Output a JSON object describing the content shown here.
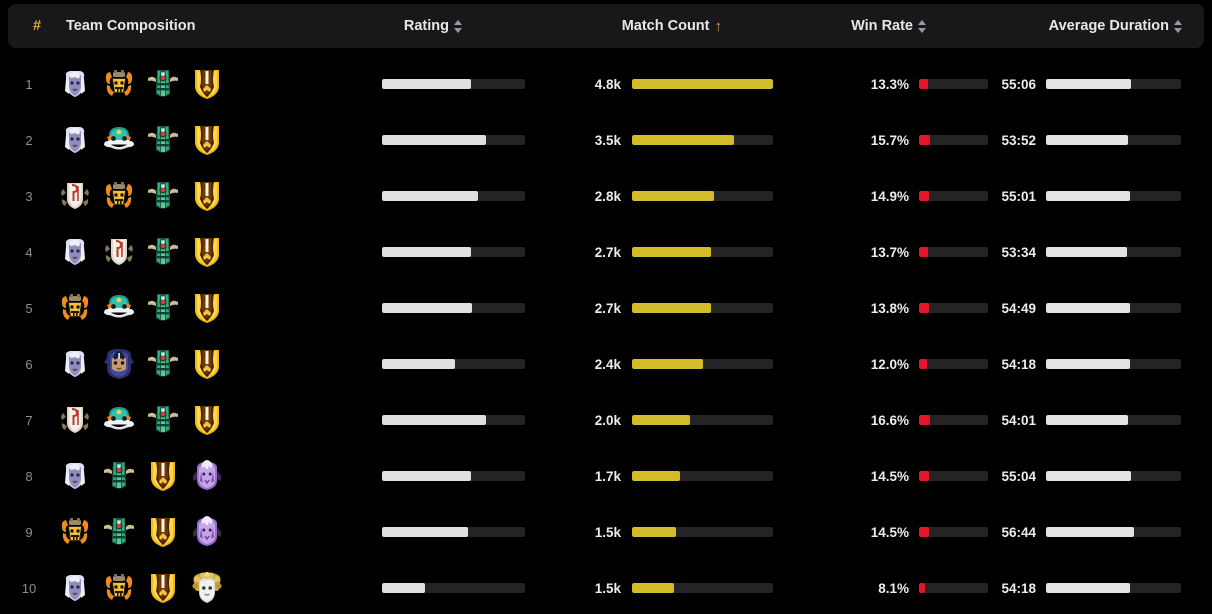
{
  "table": {
    "columns": [
      {
        "key": "rank",
        "label": "#",
        "sort": "none"
      },
      {
        "key": "comp",
        "label": "Team Composition",
        "sort": "none"
      },
      {
        "key": "rating",
        "label": "Rating",
        "sort": "sortable"
      },
      {
        "key": "match",
        "label": "Match Count",
        "sort": "asc"
      },
      {
        "key": "winrate",
        "label": "Win Rate",
        "sort": "sortable"
      },
      {
        "key": "duration",
        "label": "Average Duration",
        "sort": "sortable"
      }
    ],
    "sort_active_arrow": "↑"
  },
  "colors": {
    "page_bg": "#000000",
    "header_bg": "#18181b",
    "accent_gold": "#d9a441",
    "bar_rating": "#e0e0e2",
    "bar_match": "#d4bb2c",
    "bar_winrate": "#e8152a",
    "bar_duration": "#e4e4e7",
    "track": "#242427"
  },
  "heroes": {
    "drow": {
      "name": "drow-ranger-icon"
    },
    "clock": {
      "name": "clockwerk-icon"
    },
    "treant": {
      "name": "treant-protector-icon"
    },
    "shield": {
      "name": "dragon-knight-icon"
    },
    "juggo": {
      "name": "juggernaut-icon"
    },
    "skywrath": {
      "name": "skywrath-mage-icon"
    },
    "ghost": {
      "name": "death-prophet-icon"
    },
    "medusa": {
      "name": "medusa-icon"
    }
  },
  "rows": [
    {
      "rank": "1",
      "comp": [
        "drow",
        "clock",
        "treant",
        "shield"
      ],
      "rating": {
        "pct": 62
      },
      "match": {
        "label": "4.8k",
        "pct": 100
      },
      "winrate": {
        "label": "13.3%",
        "pct": 13.3
      },
      "duration": {
        "label": "55:06",
        "pct": 63
      }
    },
    {
      "rank": "2",
      "comp": [
        "drow",
        "juggo",
        "treant",
        "shield"
      ],
      "rating": {
        "pct": 73
      },
      "match": {
        "label": "3.5k",
        "pct": 72
      },
      "winrate": {
        "label": "15.7%",
        "pct": 15.7
      },
      "duration": {
        "label": "53:52",
        "pct": 61
      }
    },
    {
      "rank": "3",
      "comp": [
        "ghost",
        "clock",
        "treant",
        "shield"
      ],
      "rating": {
        "pct": 67
      },
      "match": {
        "label": "2.8k",
        "pct": 58
      },
      "winrate": {
        "label": "14.9%",
        "pct": 14.9
      },
      "duration": {
        "label": "55:01",
        "pct": 62
      }
    },
    {
      "rank": "4",
      "comp": [
        "drow",
        "ghost",
        "treant",
        "shield"
      ],
      "rating": {
        "pct": 62
      },
      "match": {
        "label": "2.7k",
        "pct": 56
      },
      "winrate": {
        "label": "13.7%",
        "pct": 13.7
      },
      "duration": {
        "label": "53:34",
        "pct": 60
      }
    },
    {
      "rank": "5",
      "comp": [
        "clock",
        "juggo",
        "treant",
        "shield"
      ],
      "rating": {
        "pct": 63
      },
      "match": {
        "label": "2.7k",
        "pct": 56
      },
      "winrate": {
        "label": "13.8%",
        "pct": 13.8
      },
      "duration": {
        "label": "54:49",
        "pct": 62
      }
    },
    {
      "rank": "6",
      "comp": [
        "drow",
        "skywrath",
        "treant",
        "shield"
      ],
      "rating": {
        "pct": 51
      },
      "match": {
        "label": "2.4k",
        "pct": 50
      },
      "winrate": {
        "label": "12.0%",
        "pct": 12.0
      },
      "duration": {
        "label": "54:18",
        "pct": 62
      }
    },
    {
      "rank": "7",
      "comp": [
        "ghost",
        "juggo",
        "treant",
        "shield"
      ],
      "rating": {
        "pct": 73
      },
      "match": {
        "label": "2.0k",
        "pct": 41
      },
      "winrate": {
        "label": "16.6%",
        "pct": 16.6
      },
      "duration": {
        "label": "54:01",
        "pct": 61
      }
    },
    {
      "rank": "8",
      "comp": [
        "drow",
        "treant",
        "shield",
        "skywrath2"
      ],
      "rating": {
        "pct": 62
      },
      "match": {
        "label": "1.7k",
        "pct": 34
      },
      "winrate": {
        "label": "14.5%",
        "pct": 14.5
      },
      "duration": {
        "label": "55:04",
        "pct": 63
      }
    },
    {
      "rank": "9",
      "comp": [
        "clock",
        "treant",
        "shield",
        "skywrath2"
      ],
      "rating": {
        "pct": 60
      },
      "match": {
        "label": "1.5k",
        "pct": 31
      },
      "winrate": {
        "label": "14.5%",
        "pct": 14.5
      },
      "duration": {
        "label": "56:44",
        "pct": 65
      }
    },
    {
      "rank": "10",
      "comp": [
        "drow",
        "clock",
        "shield",
        "medusa"
      ],
      "rating": {
        "pct": 30
      },
      "match": {
        "label": "1.5k",
        "pct": 30
      },
      "winrate": {
        "label": "8.1%",
        "pct": 8.1
      },
      "duration": {
        "label": "54:18",
        "pct": 62
      }
    }
  ]
}
